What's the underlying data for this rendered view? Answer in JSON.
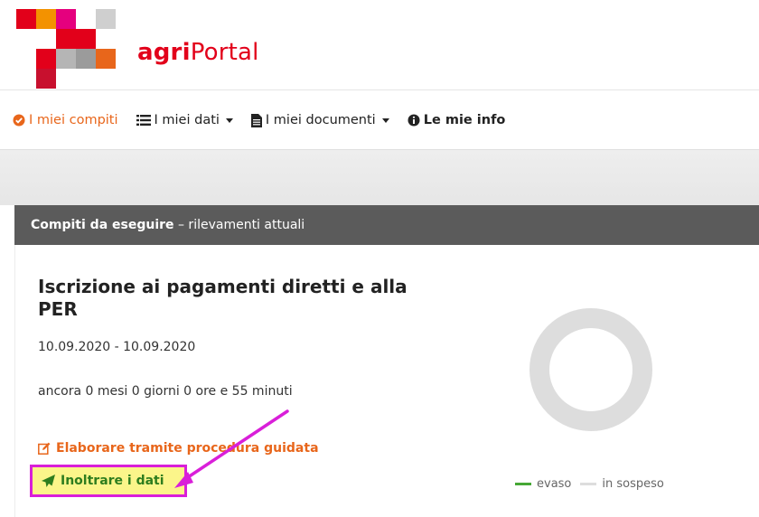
{
  "brand": {
    "prefix": "agri",
    "suffix": "Portal"
  },
  "nav": {
    "items": [
      {
        "label": "I miei compiti",
        "icon": "check-circle-icon",
        "active": true
      },
      {
        "label": "I miei dati",
        "icon": "list-icon",
        "dropdown": true
      },
      {
        "label": "I miei documenti",
        "icon": "document-icon",
        "dropdown": true
      },
      {
        "label": "Le mie info",
        "icon": "info-circle-icon"
      }
    ]
  },
  "card": {
    "header_bold": "Compiti da eseguire",
    "header_rest": " – rilevamenti attuali",
    "task": {
      "title": "Iscrizione ai pagamenti diretti e alla PER",
      "dates": "10.09.2020 - 10.09.2020",
      "remaining": "ancora 0 mesi 0 giorni 0 ore e 55 minuti",
      "action_guided": "Elaborare tramite procedura guidata",
      "action_submit": "Inoltrare i dati"
    },
    "progress": {
      "done_fraction": 0,
      "legend": [
        {
          "label": "evaso",
          "color": "#46a835"
        },
        {
          "label": "in sospeso",
          "color": "#dddddd"
        }
      ]
    }
  },
  "colors": {
    "brand_red": "#e2001a",
    "accent_orange": "#e8661b",
    "highlight_yellow": "#fbf58a",
    "annotation_magenta": "#d91fd9"
  }
}
